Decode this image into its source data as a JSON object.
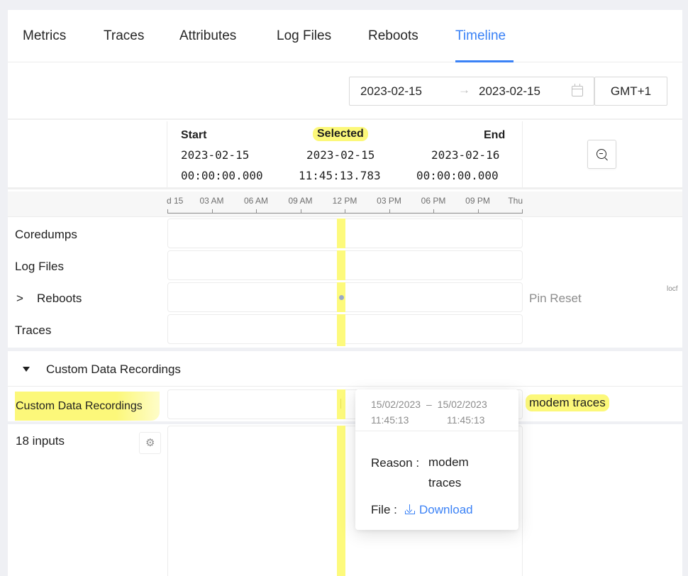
{
  "tabs": [
    {
      "label": "Metrics",
      "active": false
    },
    {
      "label": "Traces",
      "active": false
    },
    {
      "label": "Attributes",
      "active": false
    },
    {
      "label": "Log Files",
      "active": false
    },
    {
      "label": "Reboots",
      "active": false
    },
    {
      "label": "Timeline",
      "active": true
    }
  ],
  "date_range": {
    "start": "2023-02-15",
    "separator": "→",
    "end": "2023-02-15",
    "calendar_icon": "calendar-icon"
  },
  "timezone": "GMT+1",
  "header": {
    "start": {
      "label": "Start",
      "date": "2023-02-15",
      "time": "00:00:00.000"
    },
    "selected": {
      "label": "Selected",
      "date": "2023-02-15",
      "time": "11:45:13.783"
    },
    "end": {
      "label": "End",
      "date": "2023-02-16",
      "time": "00:00:00.000"
    },
    "zoom_out_icon": "zoom-out-icon"
  },
  "axis": {
    "ticks": [
      "d 15",
      "03 AM",
      "06 AM",
      "09 AM",
      "12 PM",
      "03 PM",
      "06 PM",
      "09 PM",
      "Thu"
    ],
    "selected_fraction": 0.49
  },
  "rows": [
    {
      "label": "Coredumps",
      "expandable": false
    },
    {
      "label": "Log Files",
      "expandable": false
    },
    {
      "label": "Reboots",
      "expandable": true,
      "expand_glyph": ">",
      "side_text": "Pin Reset",
      "side_tag": "locf"
    },
    {
      "label": "Traces",
      "expandable": false
    }
  ],
  "section": {
    "title": "Custom Data Recordings",
    "row_label": "Custom Data Recordings",
    "row_side_text": "modem traces",
    "inputs_label": "18 inputs",
    "settings_icon": "gear-icon"
  },
  "tooltip": {
    "from_date": "15/02/2023",
    "dash": "–",
    "to_date": "15/02/2023",
    "from_time": "11:45:13",
    "to_time": "11:45:13",
    "reason_label": "Reason :",
    "reason_value": "modem traces",
    "file_label": "File :",
    "download_label": "Download"
  },
  "colors": {
    "accent": "#3b82f6",
    "highlight": "#fcf87a",
    "event_dot": "#9aa9c8"
  }
}
